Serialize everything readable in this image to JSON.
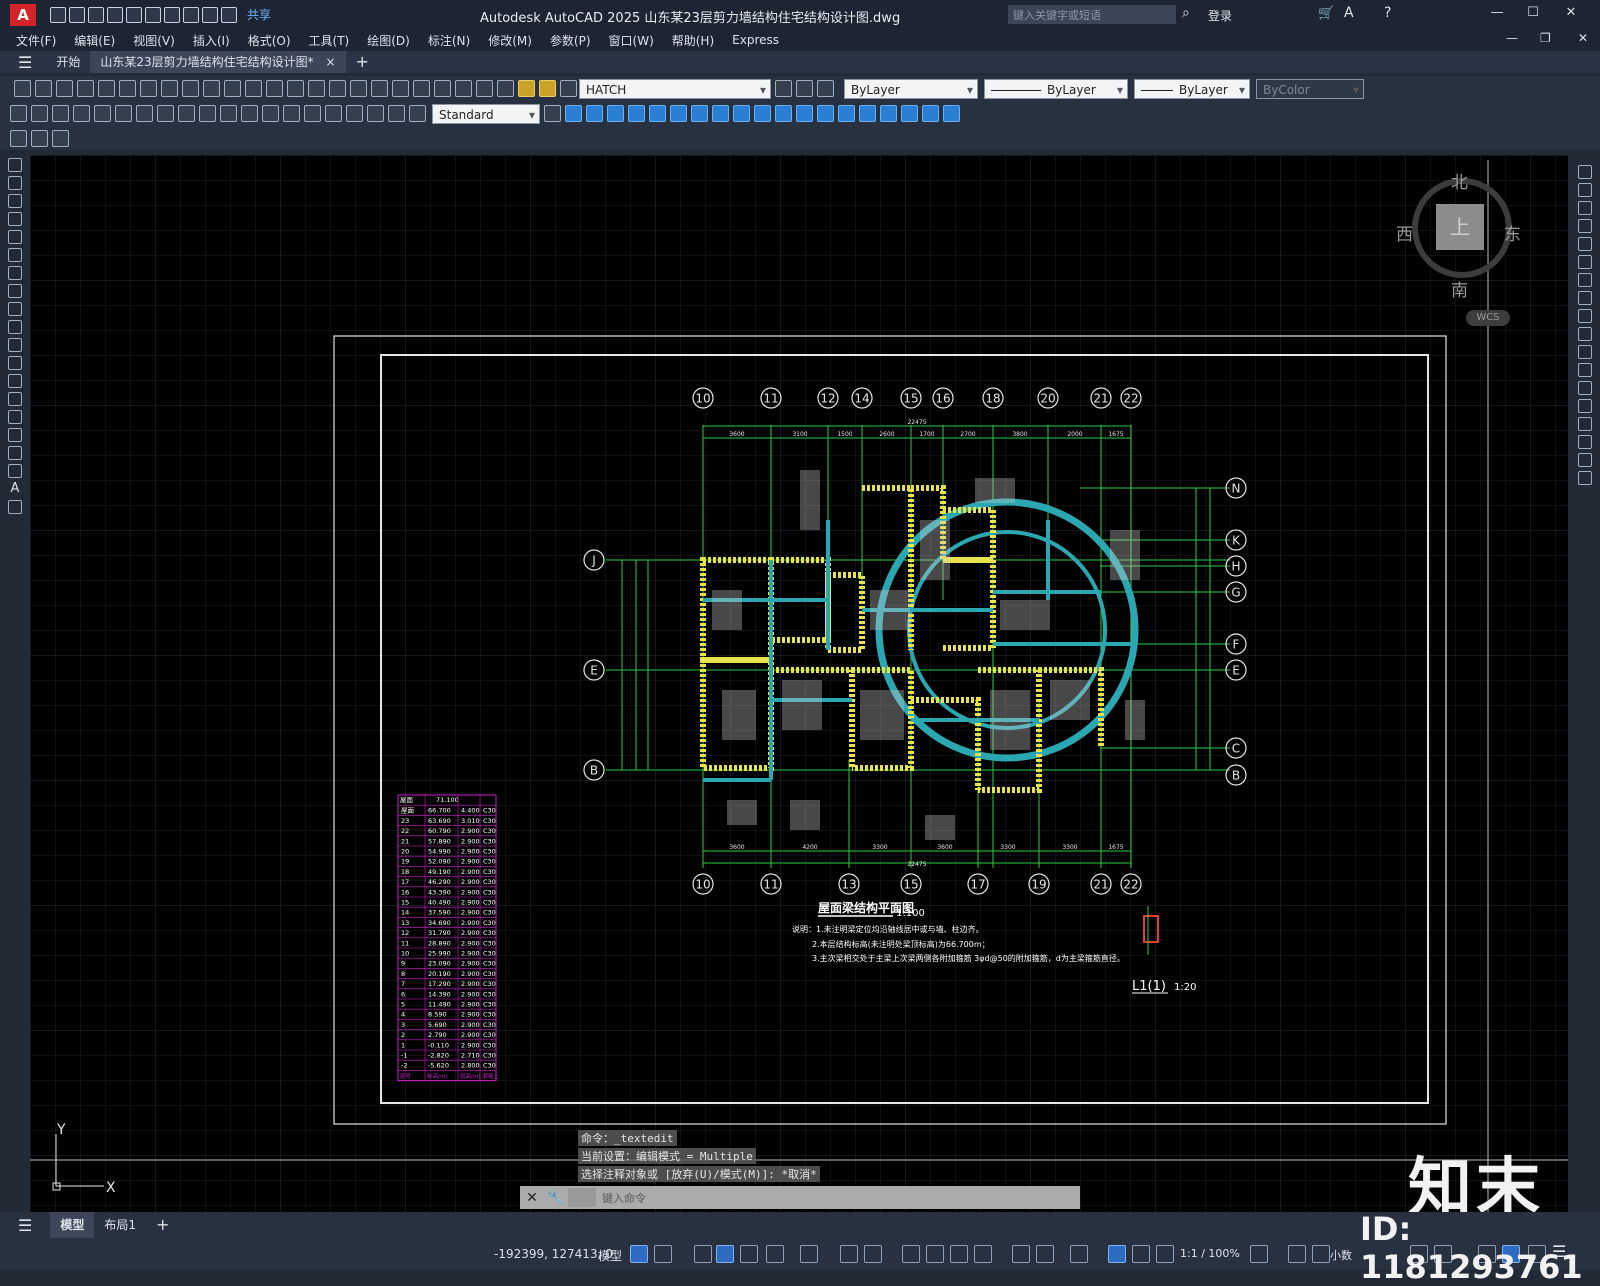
{
  "app": {
    "logo_letter": "A",
    "share_label": "共享",
    "title": "Autodesk AutoCAD 2025    山东某23层剪力墙结构住宅结构设计图.dwg",
    "search_placeholder": "键入关键字或短语",
    "login_label": "登录",
    "accent_color": "#d6232a"
  },
  "menu": [
    "文件(F)",
    "编辑(E)",
    "视图(V)",
    "插入(I)",
    "格式(O)",
    "工具(T)",
    "绘图(D)",
    "标注(N)",
    "修改(M)",
    "参数(P)",
    "窗口(W)",
    "帮助(H)",
    "Express"
  ],
  "doc_tabs": {
    "start": "开始",
    "active": "山东某23层剪力墙结构住宅结构设计图*",
    "close": "×",
    "add": "+"
  },
  "toolbar": {
    "layer_value": "HATCH",
    "text_style": "Standard",
    "color": "ByLayer",
    "linetype": "ByLayer",
    "lineweight": "ByLayer",
    "plotstyle": "ByColor"
  },
  "viewcube": {
    "north": "北",
    "south": "南",
    "west": "西",
    "east": "东",
    "face": "上",
    "wcs": "WCS"
  },
  "drawing": {
    "axes_top": [
      "10",
      "11",
      "12",
      "14",
      "15",
      "16",
      "18",
      "20",
      "21",
      "22"
    ],
    "axes_bottom": [
      "10",
      "11",
      "13",
      "15",
      "17",
      "19",
      "21",
      "22"
    ],
    "axes_left": [
      "J",
      "E",
      "B"
    ],
    "axes_right": [
      "N",
      "K",
      "H",
      "G",
      "F",
      "E",
      "C",
      "B"
    ],
    "overall_dim": "22475",
    "top_dims": [
      "3600",
      "3100",
      "1500",
      "2600",
      "1700",
      "2700",
      "3800",
      "2000",
      "1675"
    ],
    "bottom_dims": [
      "3600",
      "4200",
      "3300",
      "3600",
      "3300",
      "3300",
      "1675"
    ],
    "plan_title": "屋面梁结构平面图",
    "plan_scale": "1:100",
    "notes": [
      "说明：1.未注明梁定位均沿轴线居中或与墙、柱边齐。",
      "2.本层结构标高(未注明处梁顶标高)为66.700m；",
      "3.主次梁相交处于主梁上次梁两侧各附加箍筋 3φd@50的附加箍筋，d为主梁箍筋直径。"
    ],
    "detail_label": "L1(1)",
    "detail_scale": "1:20",
    "table_header": {
      "level": "屋面",
      "elev": "71.100"
    },
    "table_rows": [
      [
        "屋面",
        "66.700",
        "4.400",
        "C30"
      ],
      [
        "23",
        "63.690",
        "3.010",
        "C30"
      ],
      [
        "22",
        "60.790",
        "2.900",
        "C30"
      ],
      [
        "21",
        "57.890",
        "2.900",
        "C30"
      ],
      [
        "20",
        "54.990",
        "2.900",
        "C30"
      ],
      [
        "19",
        "52.090",
        "2.900",
        "C30"
      ],
      [
        "18",
        "49.190",
        "2.900",
        "C30"
      ],
      [
        "17",
        "46.290",
        "2.900",
        "C30"
      ],
      [
        "16",
        "43.390",
        "2.900",
        "C30"
      ],
      [
        "15",
        "40.490",
        "2.900",
        "C30"
      ],
      [
        "14",
        "37.590",
        "2.900",
        "C30"
      ],
      [
        "13",
        "34.690",
        "2.900",
        "C30"
      ],
      [
        "12",
        "31.790",
        "2.900",
        "C30"
      ],
      [
        "11",
        "28.890",
        "2.900",
        "C30"
      ],
      [
        "10",
        "25.990",
        "2.900",
        "C30"
      ],
      [
        "9",
        "23.090",
        "2.900",
        "C30"
      ],
      [
        "8",
        "20.190",
        "2.900",
        "C30"
      ],
      [
        "7",
        "17.290",
        "2.900",
        "C30"
      ],
      [
        "6",
        "14.390",
        "2.900",
        "C30"
      ],
      [
        "5",
        "11.490",
        "2.900",
        "C30"
      ],
      [
        "4",
        "8.590",
        "2.900",
        "C30"
      ],
      [
        "3",
        "5.690",
        "2.900",
        "C30"
      ],
      [
        "2",
        "2.790",
        "2.900",
        "C30"
      ],
      [
        "1",
        "-0.110",
        "2.900",
        "C30"
      ],
      [
        "-1",
        "-2.820",
        "2.710",
        "C30"
      ],
      [
        "-2",
        "-5.620",
        "2.800",
        "C30"
      ]
    ],
    "table_footer": [
      "层号",
      "标高(m)",
      "层高(m)",
      "混凝土"
    ]
  },
  "command": {
    "history": [
      "命令：_textedit",
      "当前设置：编辑模式 = Multiple",
      "选择注释对象或 [放弃(U)/模式(M)]: *取消*"
    ],
    "placeholder": "键入命令"
  },
  "layout_tabs": {
    "model": "模型",
    "layout1": "布局1",
    "add": "+"
  },
  "status": {
    "coords": "-192399, 127413, 0",
    "model": "模型",
    "scale": "1:1 / 100%",
    "units": "小数"
  },
  "watermark": {
    "brand": "知末",
    "id": "ID: 1181293761"
  }
}
